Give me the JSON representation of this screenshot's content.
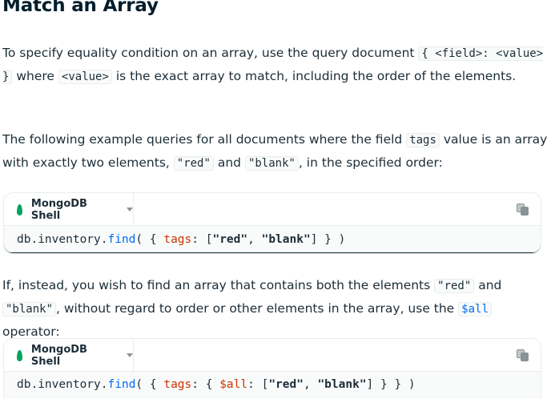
{
  "heading": "Match an Array",
  "p1": {
    "t1": "To specify equality condition on an array, use the query document ",
    "c1": "{ <field>: <value> }",
    "t2": " where ",
    "c2": "<value>",
    "t3": " is the exact array to match, including the order of the elements."
  },
  "p2": {
    "t1": "The following example queries for all documents where the field ",
    "c1": "tags",
    "t2": " value is an array with exactly two elements, ",
    "c2": "\"red\"",
    "t3": " and ",
    "c3": "\"blank\"",
    "t4": ", in the specified order:"
  },
  "block1": {
    "language": "MongoDB Shell",
    "code": {
      "a": "db.inventory.",
      "fn": "find",
      "b": "( { ",
      "key": "tags",
      "c": ": [",
      "s1": "\"red\"",
      "d": ", ",
      "s2": "\"blank\"",
      "e": "] } )"
    }
  },
  "p3": {
    "t1": "If, instead, you wish to find an array that contains both the elements ",
    "c1": "\"red\"",
    "t2": " and ",
    "c2": "\"blank\"",
    "t3": ", without regard to order or other elements in the array, use the ",
    "c3": "$all",
    "t4": " operator:"
  },
  "block2": {
    "language": "MongoDB Shell",
    "code": {
      "a": "db.inventory.",
      "fn": "find",
      "b": "( { ",
      "key": "tags",
      "c": ": { ",
      "op": "$all",
      "d": ": [",
      "s1": "\"red\"",
      "e": ", ",
      "s2": "\"blank\"",
      "f": "] } } )"
    }
  },
  "colors": {
    "accent": "#016bf8",
    "leaf": "#00a35c",
    "keyword": "#cc3300"
  },
  "icons": {
    "language": "mongodb-leaf-icon",
    "dropdown": "chevron-down-icon",
    "copy": "copy-icon"
  }
}
